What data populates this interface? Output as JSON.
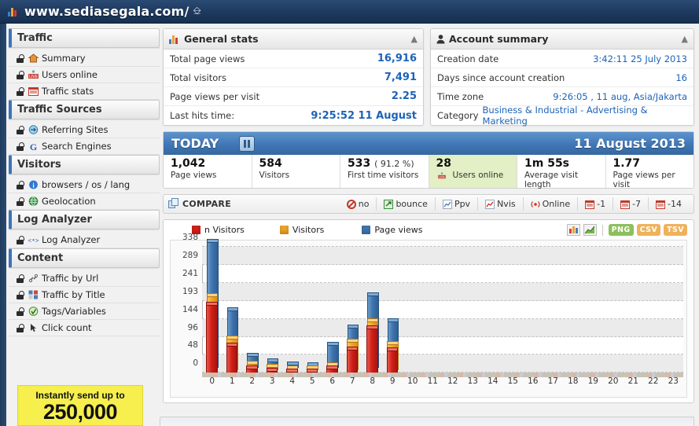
{
  "titlebar": {
    "url": "www.sediasegala.com/",
    "icon": "bar-chart-icon",
    "external_link_icon": "external-link-icon"
  },
  "sidebar": {
    "groups": [
      {
        "title": "Traffic",
        "items": [
          {
            "label": "Summary",
            "icon": "home-icon"
          },
          {
            "label": "Users online",
            "icon": "live-icon"
          },
          {
            "label": "Traffic stats",
            "icon": "calendar-icon"
          }
        ]
      },
      {
        "title": "Traffic Sources",
        "items": [
          {
            "label": "Referring Sites",
            "icon": "globe-arrow-icon"
          },
          {
            "label": "Search Engines",
            "icon": "google-g-icon"
          }
        ]
      },
      {
        "title": "Visitors",
        "items": [
          {
            "label": "browsers / os / lang",
            "icon": "info-icon"
          },
          {
            "label": "Geolocation",
            "icon": "earth-icon"
          }
        ]
      },
      {
        "title": "Log Analyzer",
        "items": [
          {
            "label": "Log Analyzer",
            "icon": "code-icon"
          }
        ]
      },
      {
        "title": "Content",
        "items": [
          {
            "label": "Traffic by Url",
            "icon": "link-icon"
          },
          {
            "label": "Traffic by Title",
            "icon": "grid-icon"
          },
          {
            "label": "Tags/Variables",
            "icon": "tag-icon"
          },
          {
            "label": "Click count",
            "icon": "cursor-icon"
          }
        ]
      }
    ]
  },
  "ad": {
    "line1": "Instantly send up to",
    "line2": "250,000"
  },
  "general_stats": {
    "title": "General stats",
    "icon": "bar-chart-icon",
    "collapse_icon": "chevron-up-icon",
    "rows": [
      {
        "label": "Total page views",
        "value": "16,916"
      },
      {
        "label": "Total visitors",
        "value": "7,491"
      },
      {
        "label": "Page views per visit",
        "value": "2.25"
      },
      {
        "label": "Last hits time:",
        "value": "9:25:52 11 August"
      }
    ]
  },
  "account_summary": {
    "title": "Account summary",
    "icon": "user-icon",
    "collapse_icon": "chevron-up-icon",
    "rows": [
      {
        "label": "Creation date",
        "value": "3:42:11 25 July 2013"
      },
      {
        "label": "Days since account creation",
        "value": "16"
      },
      {
        "label": "Time zone",
        "value": "9:26:05 , 11 aug, Asia/Jakarta"
      }
    ],
    "category_label": "Category",
    "category_value": "Business & Industrial - Advertising & Marketing"
  },
  "today": {
    "label": "TODAY",
    "date": "11 August 2013",
    "pause_icon": "pause-icon",
    "kpis": [
      {
        "value": "1,042",
        "pct": "",
        "label": "Page views",
        "icon": ""
      },
      {
        "value": "584",
        "pct": "",
        "label": "Visitors",
        "icon": ""
      },
      {
        "value": "533",
        "pct": "( 91.2 %)",
        "label": "First time visitors",
        "icon": ""
      },
      {
        "value": "28",
        "pct": "",
        "label": "Users online",
        "icon": "live-icon"
      },
      {
        "value": "1m 55s",
        "pct": "",
        "label": "Average visit length",
        "icon": ""
      },
      {
        "value": "1.77",
        "pct": "",
        "label": "Page views per visit",
        "icon": ""
      }
    ]
  },
  "compare": {
    "title": "COMPARE",
    "icon": "compare-icon",
    "buttons": [
      {
        "label": "no",
        "icon": "no-icon"
      },
      {
        "label": "bounce",
        "icon": "bounce-icon"
      },
      {
        "label": "Ppv",
        "icon": "line-chart-icon"
      },
      {
        "label": "Nvis",
        "icon": "area-chart-icon"
      },
      {
        "label": "Online",
        "icon": "broadcast-icon"
      },
      {
        "label": "-1",
        "icon": "calendar-icon"
      },
      {
        "label": "-7",
        "icon": "calendar-icon"
      },
      {
        "label": "-14",
        "icon": "calendar-icon"
      }
    ]
  },
  "chart_toolbar": {
    "icons": [
      {
        "name": "bar-chart-toggle-icon"
      },
      {
        "name": "area-chart-toggle-icon"
      }
    ],
    "formats": [
      {
        "label": "PNG",
        "color": "#7ab648"
      },
      {
        "label": "CSV",
        "color": "#e8a33d"
      },
      {
        "label": "TSV",
        "color": "#e8a33d"
      }
    ]
  },
  "chart_data": {
    "type": "bar",
    "title": "",
    "xlabel": "",
    "ylabel": "",
    "grid": true,
    "legend_position": "top",
    "ylim": [
      0,
      338
    ],
    "yticks": [
      0,
      48,
      96,
      144,
      193,
      241,
      289,
      338
    ],
    "categories": [
      "0",
      "1",
      "2",
      "3",
      "4",
      "5",
      "6",
      "7",
      "8",
      "9",
      "10",
      "11",
      "12",
      "13",
      "14",
      "15",
      "16",
      "17",
      "18",
      "19",
      "20",
      "21",
      "22",
      "23"
    ],
    "series": [
      {
        "name": "n Visitors",
        "color": "#d21f18",
        "values": [
          182,
          72,
          11,
          5,
          3,
          3,
          10,
          62,
          118,
          60,
          0,
          0,
          0,
          0,
          0,
          0,
          0,
          0,
          0,
          0,
          0,
          0,
          0,
          0
        ]
      },
      {
        "name": "Visitors",
        "color": "#eda227",
        "values": [
          198,
          84,
          17,
          8,
          5,
          5,
          13,
          76,
          131,
          70,
          0,
          0,
          0,
          0,
          0,
          0,
          0,
          0,
          0,
          0,
          0,
          0,
          0,
          0
        ]
      },
      {
        "name": "Page views",
        "color": "#3f74ad",
        "values": [
          338,
          155,
          32,
          17,
          9,
          8,
          62,
          108,
          196,
          125,
          0,
          0,
          0,
          0,
          0,
          0,
          0,
          0,
          0,
          0,
          0,
          0,
          0,
          0
        ]
      }
    ]
  }
}
